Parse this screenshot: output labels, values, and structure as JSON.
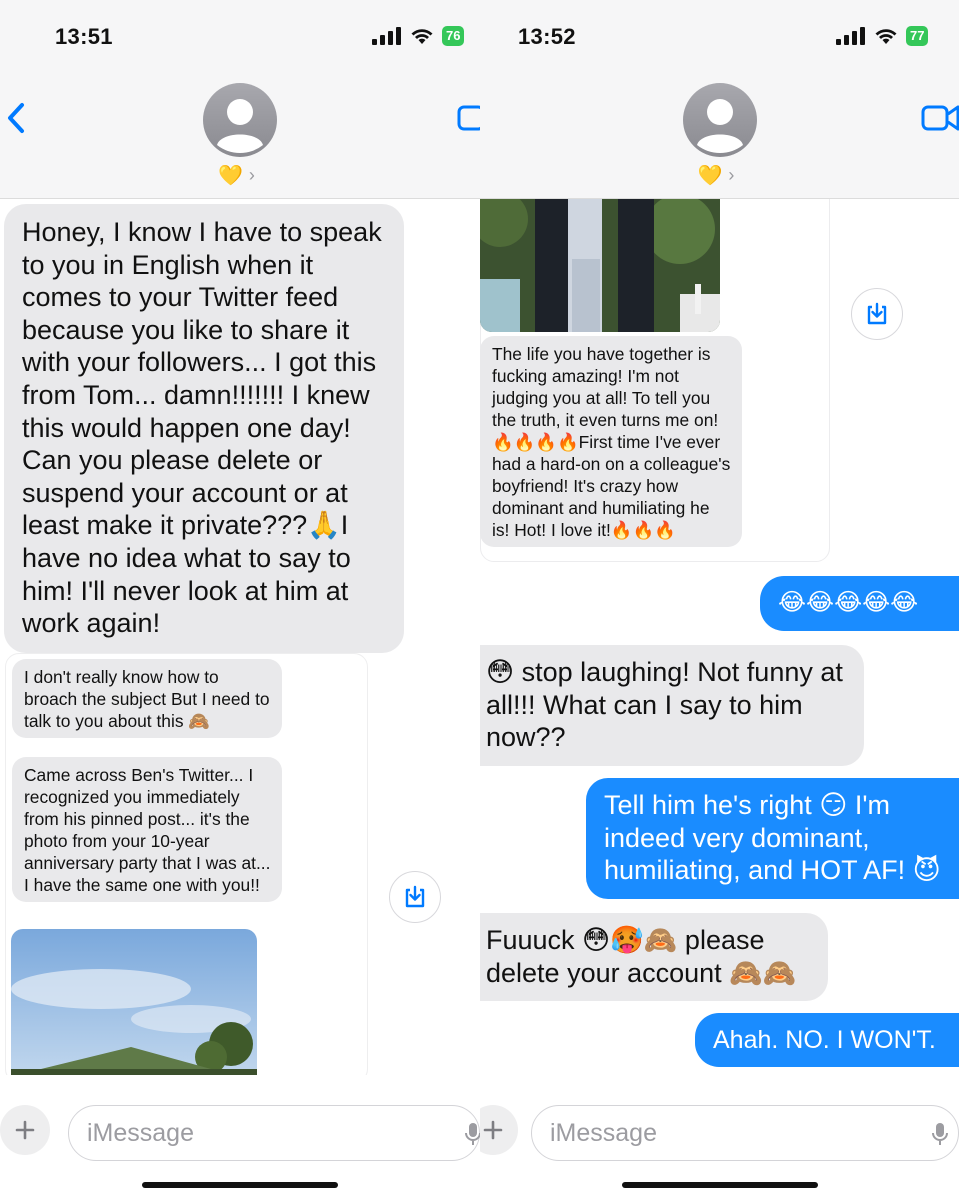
{
  "left": {
    "time": "13:51",
    "battery": "76",
    "contact_emoji": "💛",
    "messages": {
      "m1": "Honey, I know I have to speak to you in English when it comes to your Twitter feed because you like to share it with your followers... I got this from Tom... damn!!!!!!! I knew this would happen one day! Can you please delete or suspend your account or at least make it private???🙏I have no idea what to say to him! I'll never look at him at work again!",
      "m2": "I don't really know how to broach the subject But I need to talk to you about this 🙈",
      "m3": "Came across Ben's Twitter... I recognized you immediately from his pinned post... it's the photo from your 10-year anniversary party that I was at... I have the same one with you!!"
    },
    "composer_placeholder": "iMessage"
  },
  "right": {
    "time": "13:52",
    "battery": "77",
    "contact_emoji": "💛",
    "messages": {
      "m1": "The life you have together is fucking amazing! I'm not judging you at all! To tell you the truth, it even turns me on! 🔥🔥🔥🔥First time I've ever had a hard-on on a colleague's boyfriend! It's crazy how dominant and humiliating he is! Hot! I love it!🔥🔥🔥",
      "m2": "😂😂😂😂😂",
      "m3": "😳 stop laughing! Not funny at all!!! What can I say to him now??",
      "m4": "Tell him he's right 😏 I'm indeed very dominant, humiliating, and HOT AF! 😈",
      "m5": "Fuuuck 😳🥵🙈 please delete your account 🙈🙈",
      "m6": "Ahah. NO. I WON'T."
    },
    "composer_placeholder": "iMessage"
  },
  "colors": {
    "sent_bubble": "#1a8cff",
    "received_bubble": "#e9e9eb",
    "ios_blue": "#007aff",
    "battery_green": "#34c759"
  },
  "icons": [
    "back-chevron-icon",
    "contact-avatar-icon",
    "video-call-icon",
    "save-download-icon",
    "plus-icon",
    "microphone-icon",
    "signal-icon",
    "wifi-icon",
    "battery-icon"
  ]
}
